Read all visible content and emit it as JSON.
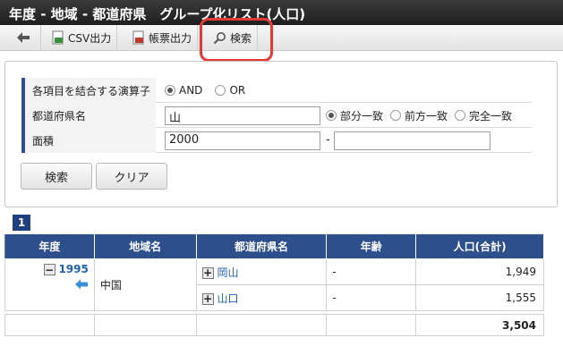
{
  "window": {
    "title": "年度 - 地域 - 都道府県　グループ化リスト(人口)"
  },
  "toolbar": {
    "back_icon": "back-arrow-icon",
    "csv_label": "CSV出力",
    "report_label": "帳票出力",
    "search_label": "検索",
    "highlight_color": "#e53935"
  },
  "search_form": {
    "operator": {
      "label": "各項目を結合する演算子",
      "options": [
        "AND",
        "OR"
      ],
      "selected": "AND"
    },
    "prefecture": {
      "label": "都道府県名",
      "value": "山",
      "match_options": [
        "部分一致",
        "前方一致",
        "完全一致"
      ],
      "selected": "部分一致"
    },
    "area": {
      "label": "面積",
      "from": "2000",
      "range_sep": "-",
      "to": ""
    },
    "buttons": {
      "search": "検索",
      "clear": "クリア"
    }
  },
  "pagination": {
    "current_page": "1"
  },
  "table": {
    "columns": [
      "年度",
      "地域名",
      "都道府県名",
      "年齢",
      "人口(合計)"
    ],
    "group": {
      "year": "1995",
      "region": "中国",
      "rows": [
        {
          "prefecture": "岡山",
          "age": "-",
          "population": "1,949"
        },
        {
          "prefecture": "山口",
          "age": "-",
          "population": "1,555"
        }
      ]
    },
    "total": {
      "population": "3,504"
    }
  },
  "colors": {
    "header_bg": "#2d4f8c",
    "title_bar": "#2a2a2a",
    "link": "#1f5fb5"
  }
}
